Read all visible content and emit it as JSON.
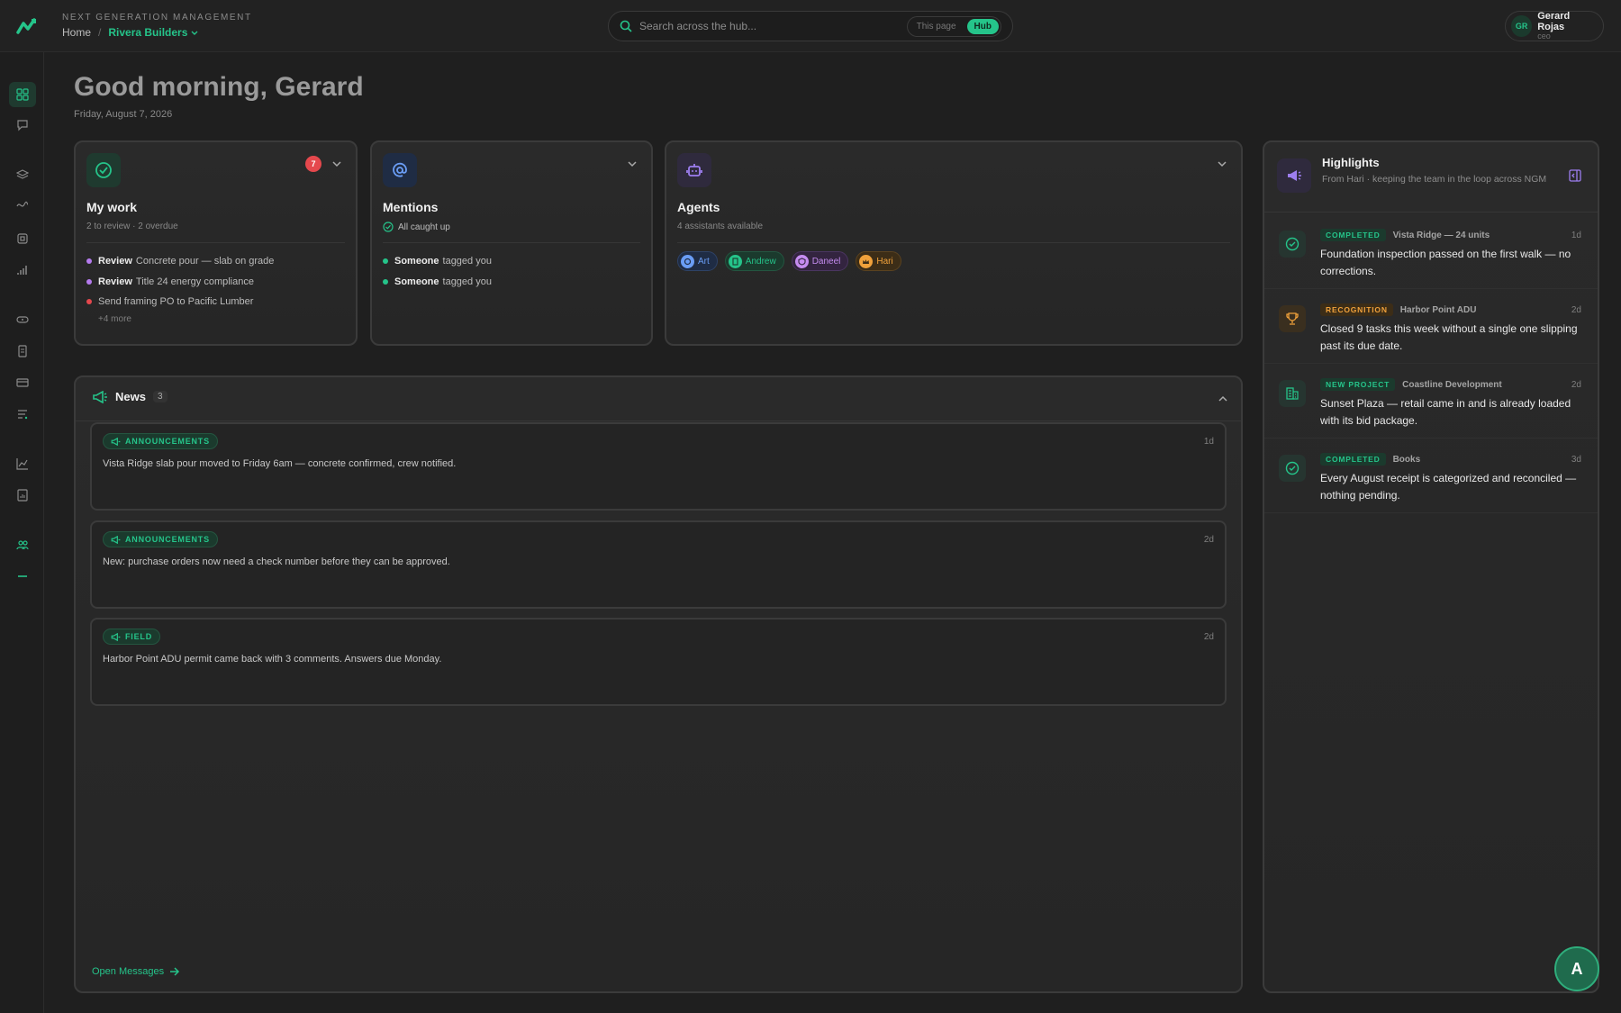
{
  "header": {
    "brand_sub": "NEXT GENERATION MANAGEMENT",
    "crumb_home": "Home",
    "crumb_sep": "/",
    "crumb_active": "Rivera Builders",
    "search_placeholder": "Search across the hub...",
    "scope_this_page": "This page",
    "scope_hub": "Hub",
    "user_initials": "GR",
    "user_name": "Gerard Rojas",
    "user_role": "ceo"
  },
  "greeting": {
    "title": "Good morning, Gerard",
    "date": "Friday, August 7, 2026"
  },
  "my_work": {
    "title": "My work",
    "subtitle": "2 to review · 2 overdue",
    "badge": "7",
    "items": [
      {
        "verb": "Review",
        "text": "Concrete pour — slab on grade",
        "color": "#b57bee"
      },
      {
        "verb": "Review",
        "text": "Title 24 energy compliance",
        "color": "#b57bee"
      },
      {
        "verb": "",
        "text": "Send framing PO to Pacific Lumber",
        "color": "#e5484d"
      }
    ],
    "more": "+4 more"
  },
  "mentions": {
    "title": "Mentions",
    "subtitle": "All caught up",
    "items": [
      {
        "who": "Someone",
        "text": "tagged you"
      },
      {
        "who": "Someone",
        "text": "tagged you"
      }
    ]
  },
  "agents": {
    "title": "Agents",
    "subtitle": "4 assistants available",
    "items": [
      {
        "name": "Art",
        "color": "#6a9df5",
        "bg": "#1f2c44",
        "icon": "brain-icon"
      },
      {
        "name": "Andrew",
        "color": "#25c48a",
        "bg": "#1b3a2d",
        "icon": "document-icon"
      },
      {
        "name": "Daneel",
        "color": "#c58cf0",
        "bg": "#33243f",
        "icon": "shield-icon"
      },
      {
        "name": "Hari",
        "color": "#f0a13b",
        "bg": "#3c2d17",
        "icon": "crown-icon"
      }
    ]
  },
  "news": {
    "title": "News",
    "count": "3",
    "items": [
      {
        "tag": "ANNOUNCEMENTS",
        "age": "1d",
        "text": "Vista Ridge slab pour moved to Friday 6am — concrete confirmed, crew notified."
      },
      {
        "tag": "ANNOUNCEMENTS",
        "age": "2d",
        "text": "New: purchase orders now need a check number before they can be approved."
      },
      {
        "tag": "FIELD",
        "age": "2d",
        "text": "Harbor Point ADU permit came back with 3 comments. Answers due Monday."
      }
    ],
    "open_label": "Open Messages"
  },
  "highlights": {
    "title": "Highlights",
    "subtitle": "From Hari · keeping the team in the loop across NGM",
    "items": [
      {
        "pill": "COMPLETED",
        "pill_kind": "green",
        "project": "Vista Ridge — 24 units",
        "age": "1d",
        "text": "Foundation inspection passed on the first walk — no corrections.",
        "icon": "check-circle-icon"
      },
      {
        "pill": "RECOGNITION",
        "pill_kind": "orange",
        "project": "Harbor Point ADU",
        "age": "2d",
        "text": "Closed 9 tasks this week without a single one slipping past its due date.",
        "icon": "trophy-icon"
      },
      {
        "pill": "NEW PROJECT",
        "pill_kind": "green",
        "project": "Coastline Development",
        "age": "2d",
        "text": "Sunset Plaza — retail came in and is already loaded with its bid package.",
        "icon": "building-icon"
      },
      {
        "pill": "COMPLETED",
        "pill_kind": "green",
        "project": "Books",
        "age": "3d",
        "text": "Every August receipt is categorized and reconciled — nothing pending.",
        "icon": "check-circle-icon"
      }
    ]
  },
  "fab_label": "A",
  "colors": {
    "accent": "#25c48a",
    "danger": "#e5484d",
    "purple": "#9d7ef0"
  }
}
